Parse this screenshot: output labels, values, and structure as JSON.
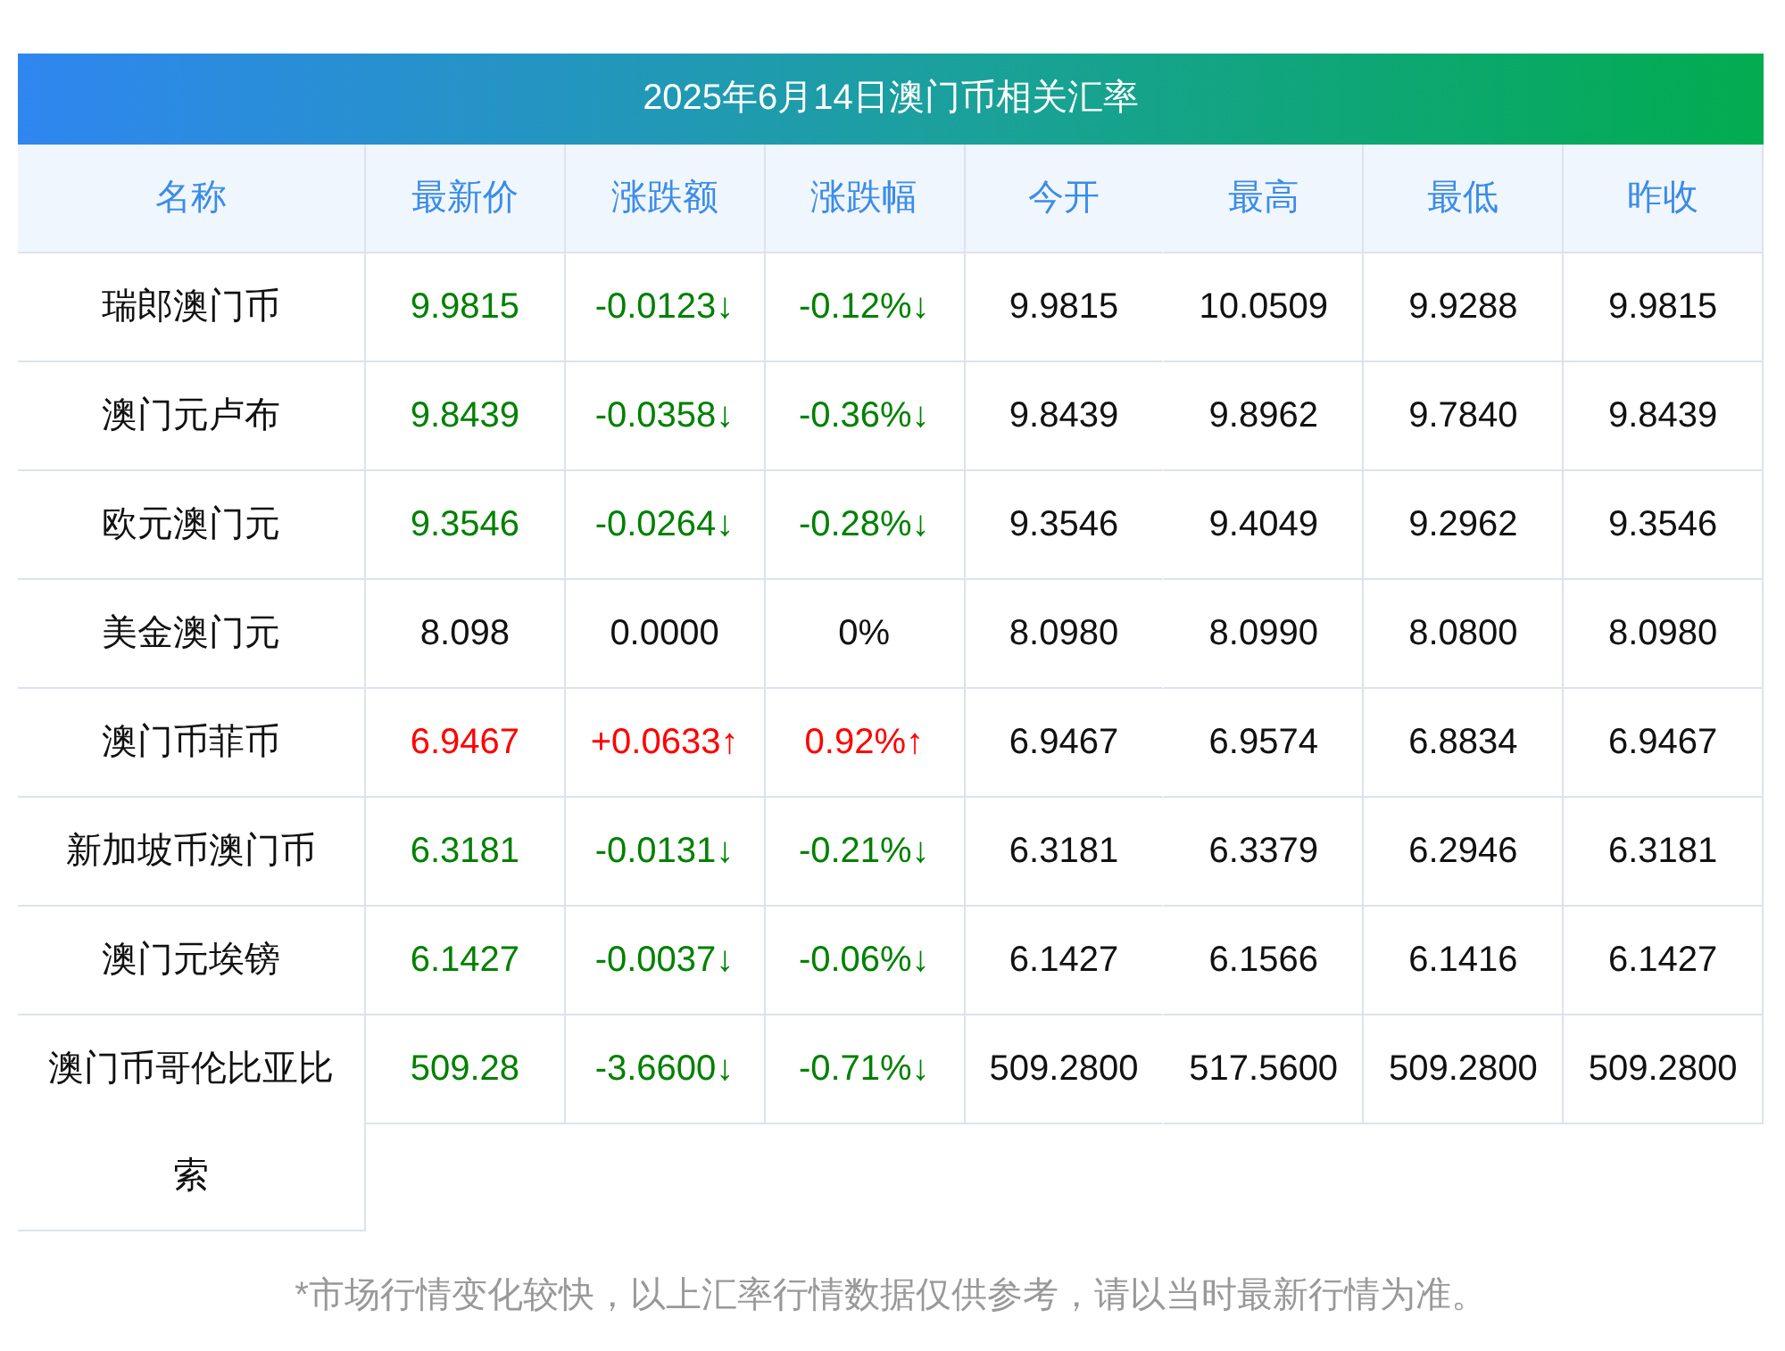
{
  "title": "2025年6月14日澳门币相关汇率",
  "columns": [
    "名称",
    "最新价",
    "涨跌额",
    "涨跌幅",
    "今开",
    "最高",
    "最低",
    "昨收"
  ],
  "rows": [
    {
      "color": "#008000",
      "cells": [
        "瑞郎澳门币",
        "9.9815",
        "-0.0123↓",
        "-0.12%↓",
        "9.9815",
        "10.0509",
        "9.9288",
        "9.9815"
      ]
    },
    {
      "color": "#008000",
      "cells": [
        "澳门元卢布",
        "9.8439",
        "-0.0358↓",
        "-0.36%↓",
        "9.8439",
        "9.8962",
        "9.7840",
        "9.8439"
      ]
    },
    {
      "color": "#008000",
      "cells": [
        "欧元澳门元",
        "9.3546",
        "-0.0264↓",
        "-0.28%↓",
        "9.3546",
        "9.4049",
        "9.2962",
        "9.3546"
      ]
    },
    {
      "color": "#111111",
      "cells": [
        "美金澳门元",
        "8.098",
        "0.0000",
        "0%",
        "8.0980",
        "8.0990",
        "8.0800",
        "8.0980"
      ]
    },
    {
      "color": "#ff0000",
      "cells": [
        "澳门币菲币",
        "6.9467",
        "+0.0633↑",
        "0.92%↑",
        "6.9467",
        "6.9574",
        "6.8834",
        "6.9467"
      ]
    },
    {
      "color": "#008000",
      "cells": [
        "新加坡币澳门币",
        "6.3181",
        "-0.0131↓",
        "-0.21%↓",
        "6.3181",
        "6.3379",
        "6.2946",
        "6.3181"
      ]
    },
    {
      "color": "#008000",
      "cells": [
        "澳门元埃镑",
        "6.1427",
        "-0.0037↓",
        "-0.06%↓",
        "6.1427",
        "6.1566",
        "6.1416",
        "6.1427"
      ]
    },
    {
      "color": "#008000",
      "cells": [
        "澳门币哥伦比亚比索",
        "509.28",
        "-3.6600↓",
        "-0.71%↓",
        "509.2800",
        "517.5600",
        "509.2800",
        "509.2800"
      ]
    }
  ],
  "note": "*市场行情变化较快，以上汇率行情数据仅供参考，请以当时最新行情为准。"
}
